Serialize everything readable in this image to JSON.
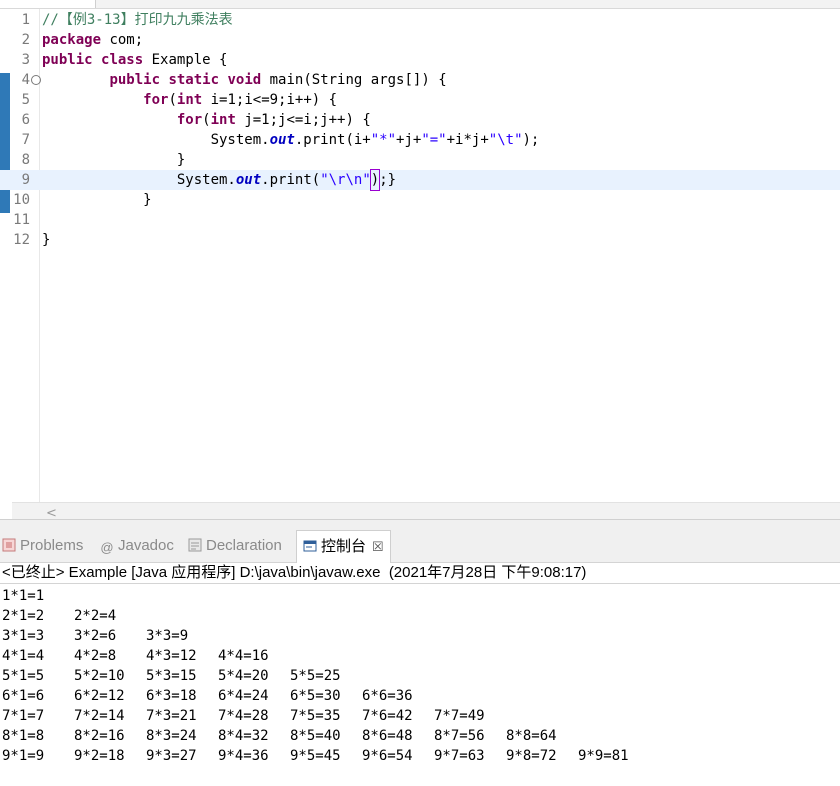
{
  "editor": {
    "lines": [
      {
        "num": "1",
        "html": "<span class=\"cmt\">//【例3-13】打印九九乘法表</span>"
      },
      {
        "num": "2",
        "html": "<span class=\"kw\">package</span> com;"
      },
      {
        "num": "3",
        "html": "<span class=\"kw\">public</span> <span class=\"kw\">class</span> Example {"
      },
      {
        "num": "4",
        "html": "        <span class=\"kw\">public</span> <span class=\"kw\">static</span> <span class=\"kw\">void</span> main(String args[]) {"
      },
      {
        "num": "5",
        "html": "            <span class=\"kw\">for</span>(<span class=\"kw\">int</span> i=1;i&lt;=9;i++) {"
      },
      {
        "num": "6",
        "html": "                <span class=\"kw\">for</span>(<span class=\"kw\">int</span> j=1;j&lt;=i;j++) {"
      },
      {
        "num": "7",
        "html": "                    System.<span class=\"fld\">out</span>.print(i+<span class=\"str\">\"*\"</span>+j+<span class=\"str\">\"=\"</span>+i*j+<span class=\"str\">\"\\t\"</span>);"
      },
      {
        "num": "8",
        "html": "                }"
      },
      {
        "num": "9",
        "html": "                System.<span class=\"fld\">out</span>.print(<span class=\"str\">\"\\r\\n\"</span><span class=\"caret\">)</span>;}"
      },
      {
        "num": "10",
        "html": "            }"
      },
      {
        "num": "11",
        "html": ""
      },
      {
        "num": "12",
        "html": "}"
      }
    ],
    "current_line": 9,
    "folded_line_marker": "⊖"
  },
  "hscroll": {
    "left_arrow": "<"
  },
  "view_tabs": [
    {
      "label": "Problems",
      "icon": "problems-icon",
      "active": false
    },
    {
      "label": "Javadoc",
      "icon": "at-icon",
      "active": false
    },
    {
      "label": "Declaration",
      "icon": "declaration-icon",
      "active": false
    },
    {
      "label": "控制台",
      "icon": "console-icon",
      "active": true,
      "close": "☒"
    }
  ],
  "console": {
    "title": "<已终止> Example [Java 应用程序] D:\\java\\bin\\javaw.exe  (2021年7月28日 下午9:08:17)",
    "rows": [
      [
        "1*1=1"
      ],
      [
        "2*1=2",
        "2*2=4"
      ],
      [
        "3*1=3",
        "3*2=6",
        "3*3=9"
      ],
      [
        "4*1=4",
        "4*2=8",
        "4*3=12",
        "4*4=16"
      ],
      [
        "5*1=5",
        "5*2=10",
        "5*3=15",
        "5*4=20",
        "5*5=25"
      ],
      [
        "6*1=6",
        "6*2=12",
        "6*3=18",
        "6*4=24",
        "6*5=30",
        "6*6=36"
      ],
      [
        "7*1=7",
        "7*2=14",
        "7*3=21",
        "7*4=28",
        "7*5=35",
        "7*6=42",
        "7*7=49"
      ],
      [
        "8*1=8",
        "8*2=16",
        "8*3=24",
        "8*4=32",
        "8*5=40",
        "8*6=48",
        "8*7=56",
        "8*8=64"
      ],
      [
        "9*1=9",
        "9*2=18",
        "9*3=27",
        "9*4=36",
        "9*5=45",
        "9*6=54",
        "9*7=63",
        "9*8=72",
        "9*9=81"
      ]
    ]
  },
  "colors": {
    "keyword": "#7f0055",
    "string": "#2a00ff",
    "comment": "#3f7f5f",
    "field": "#0000c0",
    "current_line": "#e8f2fe",
    "ruler": "#2f79b7"
  }
}
